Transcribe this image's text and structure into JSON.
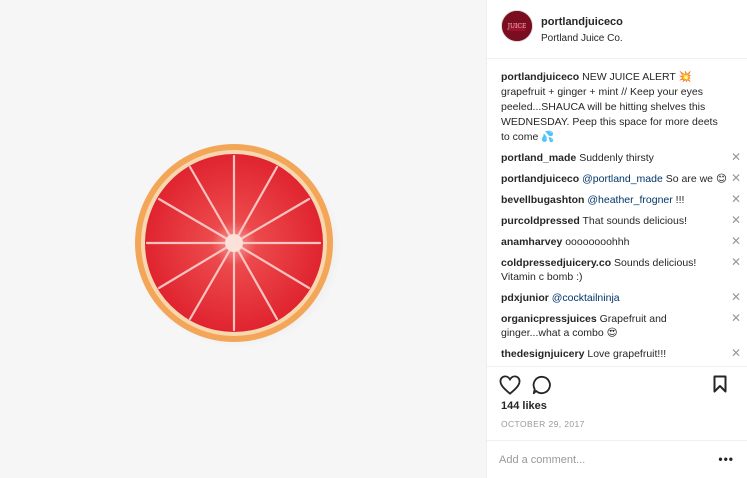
{
  "post": {
    "username": "portlandjuiceco",
    "location": "Portland Juice Co.",
    "avatar_text": "JUICE"
  },
  "caption": {
    "user": "portlandjuiceco",
    "text": "NEW JUICE ALERT 💥 grapefruit + ginger + mint // Keep your eyes peeled...SHAUCA will be hitting shelves this WEDNESDAY. Peep this space for more deets to come 💦"
  },
  "comments": [
    {
      "user": "portland_made",
      "pre": "Suddenly thirsty",
      "mention": "",
      "post": ""
    },
    {
      "user": "portlandjuiceco",
      "pre": "",
      "mention": "@portland_made",
      "post": "So are we 😊"
    },
    {
      "user": "bevellbugashton",
      "pre": "",
      "mention": "@heather_frogner",
      "post": "!!!"
    },
    {
      "user": "purcoldpressed",
      "pre": "That sounds delicious!",
      "mention": "",
      "post": ""
    },
    {
      "user": "anamharvey",
      "pre": "oooooooohhh",
      "mention": "",
      "post": ""
    },
    {
      "user": "coldpressedjuicery.co",
      "pre": "Sounds delicious! Vitamin c bomb :)",
      "mention": "",
      "post": ""
    },
    {
      "user": "pdxjunior",
      "pre": "",
      "mention": "@cocktailninja",
      "post": ""
    },
    {
      "user": "organicpressjuices",
      "pre": "Grapefruit and ginger...what a combo 😍",
      "mention": "",
      "post": ""
    },
    {
      "user": "thedesignjuicery",
      "pre": "Love grapefruit!!!",
      "mention": "",
      "post": ""
    }
  ],
  "close_glyph": "✕",
  "likes": "144 likes",
  "date": "OCTOBER 29, 2017",
  "add_comment": {
    "placeholder": "Add a comment..."
  },
  "more_glyph": "•••",
  "icons": {
    "like": "heart-icon",
    "comment": "comment-icon",
    "save": "bookmark-icon"
  },
  "colors": {
    "mention": "#003569",
    "muted": "#999999",
    "border": "#efefef",
    "fruit": "#e8333a",
    "rind": "#f2a35b"
  }
}
